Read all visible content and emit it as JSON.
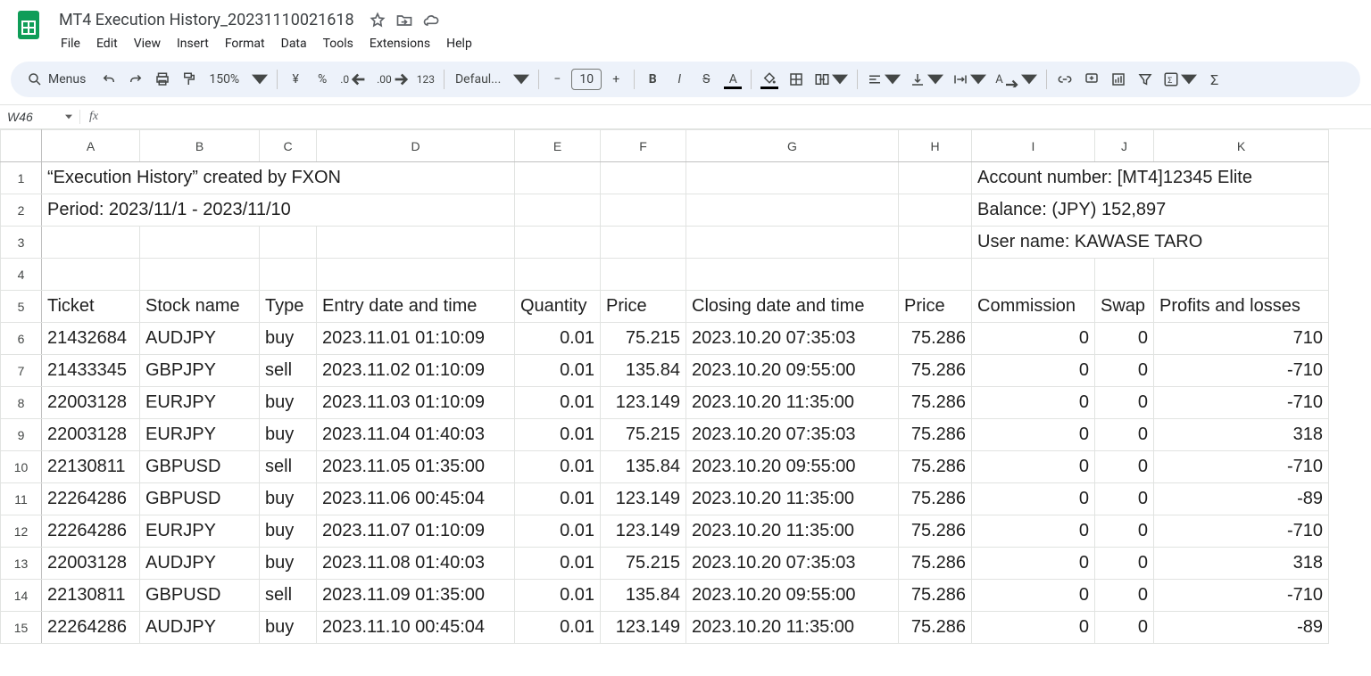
{
  "doc": {
    "title": "MT4 Execution History_20231110021618"
  },
  "menus": [
    "File",
    "Edit",
    "View",
    "Insert",
    "Format",
    "Data",
    "Tools",
    "Extensions",
    "Help"
  ],
  "toolbar": {
    "menus_label": "Menus",
    "zoom": "150%",
    "font": "Defaul...",
    "font_size": "10"
  },
  "name_box": "W46",
  "fx": "fx",
  "columns": [
    "A",
    "B",
    "C",
    "D",
    "E",
    "F",
    "G",
    "H",
    "I",
    "J",
    "K"
  ],
  "col_widths": [
    "col-A",
    "col-B",
    "col-C",
    "col-D",
    "col-E",
    "col-F",
    "col-G",
    "col-H",
    "col-I",
    "col-J",
    "col-K"
  ],
  "info": {
    "r1a": "“Execution History” created by FXON",
    "r1i": "Account number: [MT4]12345 Elite",
    "r2a": "Period: 2023/11/1 - 2023/11/10",
    "r2i": "Balance: (JPY) 152,897",
    "r3i": "User name: KAWASE TARO"
  },
  "headers": {
    "A": "Ticket",
    "B": "Stock name",
    "C": "Type",
    "D": "Entry date and time",
    "E": "Quantity",
    "F": "Price",
    "G": "Closing date and time",
    "H": "Price",
    "I": "Commission",
    "J": "Swap",
    "K": "Profits and losses"
  },
  "rows": [
    {
      "n": "6",
      "A": "21432684",
      "B": "AUDJPY",
      "C": "buy",
      "D": "2023.11.01 01:10:09",
      "E": "0.01",
      "F": "75.215",
      "G": "2023.10.20 07:35:03",
      "H": "75.286",
      "I": "0",
      "J": "0",
      "K": "710"
    },
    {
      "n": "7",
      "A": "21433345",
      "B": "GBPJPY",
      "C": "sell",
      "D": "2023.11.02 01:10:09",
      "E": "0.01",
      "F": "135.84",
      "G": "2023.10.20 09:55:00",
      "H": "75.286",
      "I": "0",
      "J": "0",
      "K": "-710"
    },
    {
      "n": "8",
      "A": "22003128",
      "B": "EURJPY",
      "C": "buy",
      "D": "2023.11.03 01:10:09",
      "E": "0.01",
      "F": "123.149",
      "G": "2023.10.20 11:35:00",
      "H": "75.286",
      "I": "0",
      "J": "0",
      "K": "-710"
    },
    {
      "n": "9",
      "A": "22003128",
      "B": "EURJPY",
      "C": "buy",
      "D": "2023.11.04 01:40:03",
      "E": "0.01",
      "F": "75.215",
      "G": "2023.10.20 07:35:03",
      "H": "75.286",
      "I": "0",
      "J": "0",
      "K": "318"
    },
    {
      "n": "10",
      "A": "22130811",
      "B": "GBPUSD",
      "C": "sell",
      "D": "2023.11.05 01:35:00",
      "E": "0.01",
      "F": "135.84",
      "G": "2023.10.20 09:55:00",
      "H": "75.286",
      "I": "0",
      "J": "0",
      "K": "-710"
    },
    {
      "n": "11",
      "A": "22264286",
      "B": "GBPUSD",
      "C": "buy",
      "D": "2023.11.06 00:45:04",
      "E": "0.01",
      "F": "123.149",
      "G": "2023.10.20 11:35:00",
      "H": "75.286",
      "I": "0",
      "J": "0",
      "K": "-89"
    },
    {
      "n": "12",
      "A": "22264286",
      "B": "EURJPY",
      "C": "buy",
      "D": "2023.11.07 01:10:09",
      "E": "0.01",
      "F": "123.149",
      "G": "2023.10.20 11:35:00",
      "H": "75.286",
      "I": "0",
      "J": "0",
      "K": "-710"
    },
    {
      "n": "13",
      "A": "22003128",
      "B": "AUDJPY",
      "C": "buy",
      "D": "2023.11.08 01:40:03",
      "E": "0.01",
      "F": "75.215",
      "G": "2023.10.20 07:35:03",
      "H": "75.286",
      "I": "0",
      "J": "0",
      "K": "318"
    },
    {
      "n": "14",
      "A": "22130811",
      "B": "GBPUSD",
      "C": "sell",
      "D": "2023.11.09 01:35:00",
      "E": "0.01",
      "F": "135.84",
      "G": "2023.10.20 09:55:00",
      "H": "75.286",
      "I": "0",
      "J": "0",
      "K": "-710"
    },
    {
      "n": "15",
      "A": "22264286",
      "B": "AUDJPY",
      "C": "buy",
      "D": "2023.11.10 00:45:04",
      "E": "0.01",
      "F": "123.149",
      "G": "2023.10.20 11:35:00",
      "H": "75.286",
      "I": "0",
      "J": "0",
      "K": "-89"
    }
  ],
  "numeric_cols": [
    "E",
    "F",
    "H",
    "I",
    "J",
    "K"
  ]
}
